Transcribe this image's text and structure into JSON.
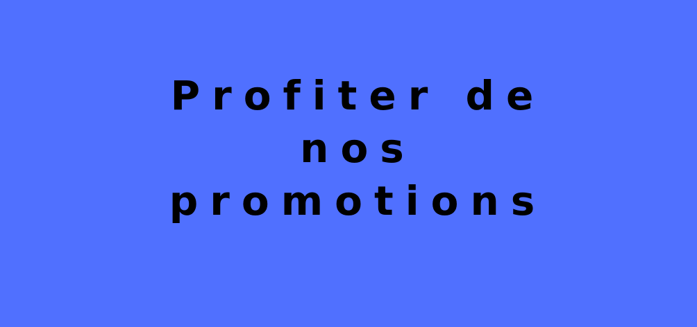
{
  "banner": {
    "background_color": "#5070ff",
    "text_color": "#000000",
    "headline_lines": [
      "Profiter de",
      "nos",
      "promotions"
    ]
  }
}
